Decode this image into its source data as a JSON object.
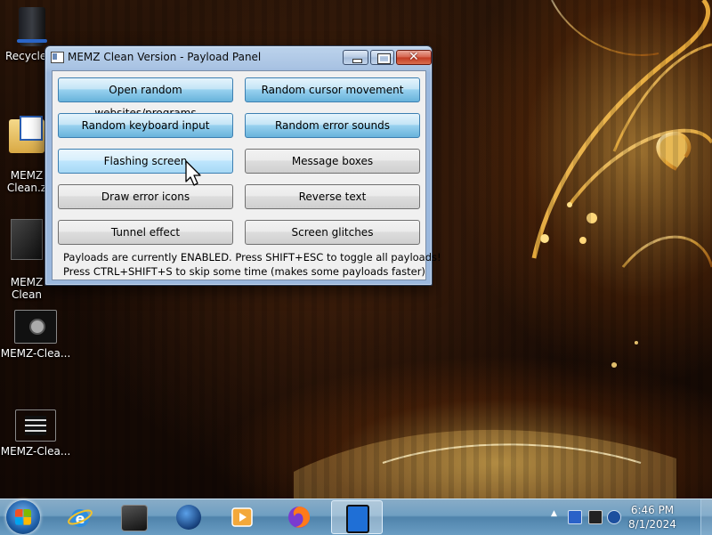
{
  "desktop": {
    "icons": [
      {
        "label": "Recycle"
      },
      {
        "label": "MEMZ\nClean.z"
      },
      {
        "label": "MEMZ\nClean"
      },
      {
        "label": "MEMZ-Clea..."
      },
      {
        "label": "MEMZ-Clea..."
      }
    ]
  },
  "window": {
    "title": "MEMZ Clean Version - Payload Panel",
    "controls": {
      "minimize": "minimize",
      "maximize": "maximize",
      "close": "✕"
    },
    "payloads": [
      {
        "label": "Open random websites/programs",
        "enabled": true
      },
      {
        "label": "Random cursor movement",
        "enabled": true
      },
      {
        "label": "Random keyboard input",
        "enabled": true
      },
      {
        "label": "Random error sounds",
        "enabled": true
      },
      {
        "label": "Flashing screen",
        "enabled": true,
        "hovered": true
      },
      {
        "label": "Message boxes",
        "enabled": false
      },
      {
        "label": "Draw error icons",
        "enabled": false
      },
      {
        "label": "Reverse text",
        "enabled": false
      },
      {
        "label": "Tunnel effect",
        "enabled": false
      },
      {
        "label": "Screen glitches",
        "enabled": false
      }
    ],
    "status_line_1": "Payloads are currently ENABLED. Press SHIFT+ESC to toggle all payloads!",
    "status_line_2": "Press CTRL+SHIFT+S to skip some time (makes some payloads faster)"
  },
  "taskbar": {
    "apps": [
      {
        "icon": "internet-explorer-icon"
      },
      {
        "icon": "computer-icon"
      },
      {
        "icon": "globe-icon"
      },
      {
        "icon": "media-player-icon"
      },
      {
        "icon": "firefox-icon"
      },
      {
        "icon": "memz-icon",
        "active": true
      }
    ],
    "tray_expand": "▲",
    "clock_time": "6:46 PM",
    "clock_date": "8/1/2024"
  }
}
